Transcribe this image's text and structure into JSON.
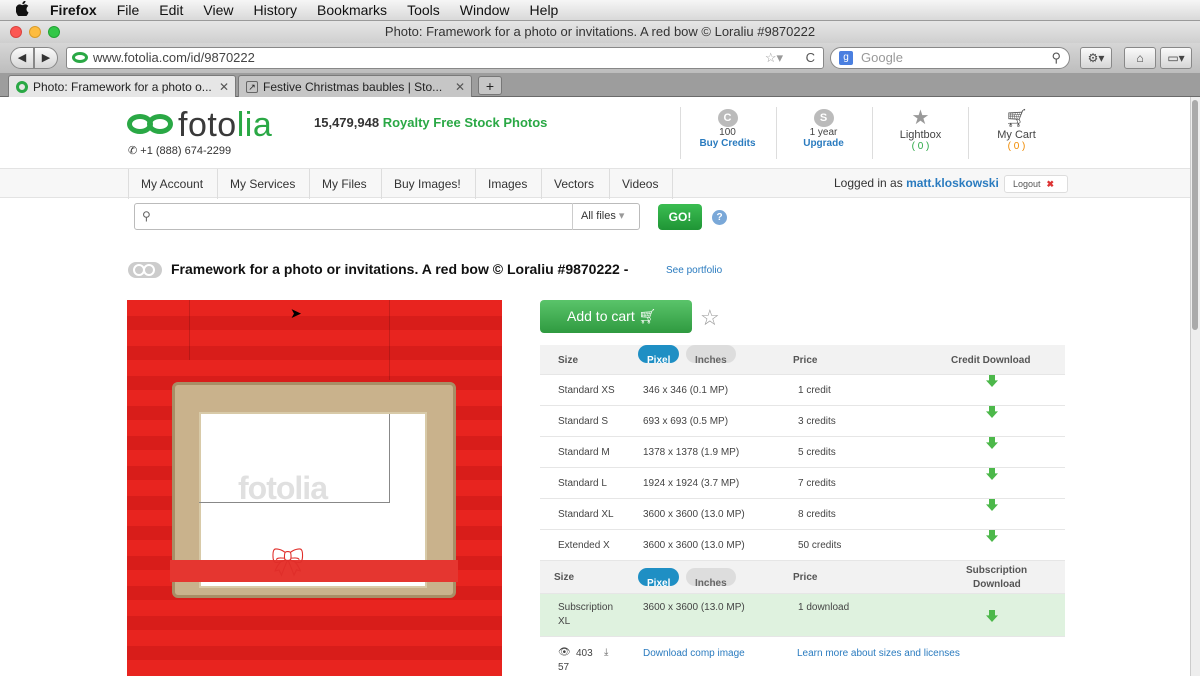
{
  "menubar": {
    "apple": "",
    "app": "Firefox",
    "items": [
      "File",
      "Edit",
      "View",
      "History",
      "Bookmarks",
      "Tools",
      "Window",
      "Help"
    ]
  },
  "window": {
    "title": "Photo: Framework for a photo or invitations. A red bow © Loraliu #9870222"
  },
  "toolbar": {
    "url": "www.fotolia.com/id/9870222",
    "search_placeholder": "Google",
    "back": "◀",
    "forward": "▶",
    "reload": "C",
    "home": "⌂"
  },
  "tabs": [
    {
      "label": "Photo: Framework for a photo o..."
    },
    {
      "label": "Festive Christmas baubles | Sto..."
    }
  ],
  "tab_new": "+",
  "site": {
    "logo": "fotolia",
    "phone": "+1 (888) 674-2299",
    "tagline_count": "15,479,948",
    "tagline_text": "Royalty Free Stock Photos",
    "credits": {
      "icon": "C",
      "value": "100",
      "link": "Buy Credits"
    },
    "subscription": {
      "icon": "S",
      "value": "1 year",
      "link": "Upgrade"
    },
    "lightbox": {
      "label": "Lightbox",
      "count": "( 0 )"
    },
    "cart": {
      "label": "My Cart",
      "count": "( 0 )"
    }
  },
  "nav": {
    "items": [
      "My Account",
      "My Services",
      "My Files",
      "Buy Images!",
      "Images",
      "Vectors",
      "Videos"
    ],
    "logged_in_label": "Logged in as",
    "username": "matt.kloskowski",
    "logout": "Logout"
  },
  "search": {
    "filter": "All files",
    "go": "GO!",
    "help": "?"
  },
  "photo": {
    "title": "Framework for a photo or invitations. A red bow © Loraliu #9870222 -",
    "see_portfolio": "See portfolio",
    "watermark": "fotolia"
  },
  "purchase": {
    "add_to_cart": "Add to cart",
    "header": {
      "size": "Size",
      "pixel": "Pixel",
      "inches": "Inches",
      "price": "Price",
      "credit_download": "Credit Download"
    },
    "rows": [
      {
        "name": "Standard XS",
        "dims": "346 x 346 (0.1 MP)",
        "price": "1 credit"
      },
      {
        "name": "Standard S",
        "dims": "693 x 693 (0.5 MP)",
        "price": "3 credits"
      },
      {
        "name": "Standard M",
        "dims": "1378 x 1378 (1.9 MP)",
        "price": "5 credits"
      },
      {
        "name": "Standard L",
        "dims": "1924 x 1924 (3.7 MP)",
        "price": "7 credits"
      },
      {
        "name": "Standard XL",
        "dims": "3600 x 3600 (13.0 MP)",
        "price": "8 credits"
      },
      {
        "name": "Extended X",
        "dims": "3600 x 3600 (13.0 MP)",
        "price": "50 credits"
      }
    ],
    "sub_header": {
      "size": "Size",
      "pixel": "Pixel",
      "inches": "Inches",
      "price": "Price",
      "download_line1": "Subscription",
      "download_line2": "Download"
    },
    "sub_row": {
      "name_line1": "Subscription",
      "name_line2": "XL",
      "dims": "3600 x 3600 (13.0 MP)",
      "price": "1 download"
    },
    "footer": {
      "views": "403",
      "downloads": "57",
      "comp_link": "Download comp image",
      "learn_link": "Learn more about sizes and licenses"
    }
  }
}
